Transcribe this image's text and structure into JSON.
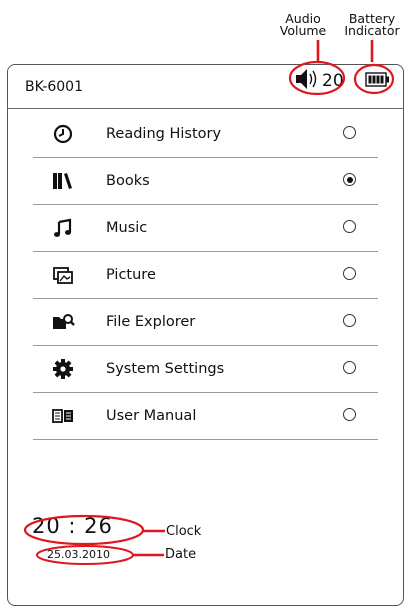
{
  "callouts": {
    "audio_volume_line1": "Audio",
    "audio_volume_line2": "Volume",
    "battery_line1": "Battery",
    "battery_line2": "Indicator",
    "clock": "Clock",
    "date": "Date"
  },
  "device": {
    "title": "BK-6001",
    "volume": "20",
    "clock": "20 : 26",
    "date": "25.03.2010"
  },
  "menu": {
    "items": [
      {
        "label": "Reading History",
        "icon": "clock-icon",
        "selected": false
      },
      {
        "label": "Books",
        "icon": "books-icon",
        "selected": true
      },
      {
        "label": "Music",
        "icon": "music-note-icon",
        "selected": false
      },
      {
        "label": "Picture",
        "icon": "picture-icon",
        "selected": false
      },
      {
        "label": "File Explorer",
        "icon": "folder-search-icon",
        "selected": false
      },
      {
        "label": "System Settings",
        "icon": "gear-icon",
        "selected": false
      },
      {
        "label": "User Manual",
        "icon": "book-open-icon",
        "selected": false
      }
    ]
  },
  "colors": {
    "highlight": "#e0161e",
    "border": "#555555"
  }
}
